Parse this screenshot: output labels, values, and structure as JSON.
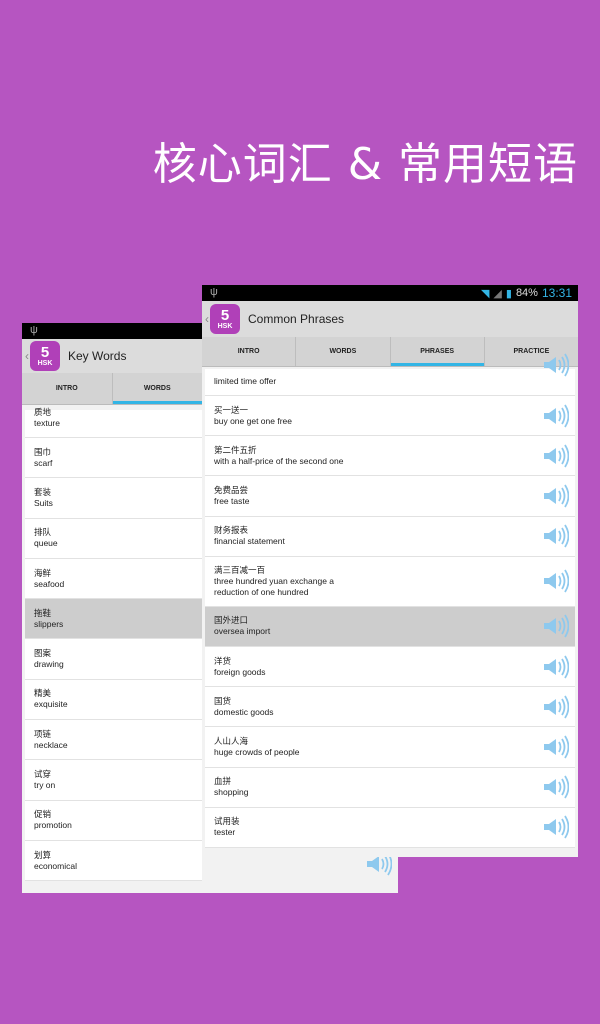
{
  "headline": "核心词汇 & 常用短语",
  "colors": {
    "background": "#b655c1",
    "accent": "#33b5e5",
    "selected_row": "#cdcdcd"
  },
  "back_phone": {
    "title": "Key Words",
    "logo": {
      "number": "5",
      "label": "HSK"
    },
    "tabs": [
      {
        "label": "INTRO"
      },
      {
        "label": "WORDS",
        "active": true
      }
    ],
    "items": [
      {
        "zh": "质地",
        "en": "texture"
      },
      {
        "zh": "围巾",
        "en": "scarf"
      },
      {
        "zh": "套装",
        "en": "Suits"
      },
      {
        "zh": "排队",
        "en": "queue"
      },
      {
        "zh": "海鲜",
        "en": "seafood"
      },
      {
        "zh": "拖鞋",
        "en": "slippers",
        "selected": true
      },
      {
        "zh": "图案",
        "en": "drawing"
      },
      {
        "zh": "精美",
        "en": "exquisite"
      },
      {
        "zh": "项链",
        "en": "necklace"
      },
      {
        "zh": "试穿",
        "en": "try on"
      },
      {
        "zh": "促销",
        "en": "promotion"
      },
      {
        "zh": "划算",
        "en": "economical"
      }
    ]
  },
  "front_phone": {
    "status": {
      "battery": "84%",
      "time": "13:31"
    },
    "title": "Common Phrases",
    "logo": {
      "number": "5",
      "label": "HSK"
    },
    "tabs": [
      {
        "label": "INTRO"
      },
      {
        "label": "WORDS"
      },
      {
        "label": "PHRASES",
        "active": true
      },
      {
        "label": "PRACTICE"
      }
    ],
    "items": [
      {
        "zh": "",
        "en": "limited time offer"
      },
      {
        "zh": "买一送一",
        "en": "buy one get one free"
      },
      {
        "zh": "第二件五折",
        "en": "with a half-price of the second one"
      },
      {
        "zh": "免费品尝",
        "en": "free taste"
      },
      {
        "zh": "财务报表",
        "en": "financial statement"
      },
      {
        "zh": "满三百减一百",
        "en": "three hundred yuan exchange a reduction of one hundred"
      },
      {
        "zh": "国外进口",
        "en": "oversea import",
        "selected": true
      },
      {
        "zh": "洋货",
        "en": "foreign goods"
      },
      {
        "zh": "国货",
        "en": "domestic goods"
      },
      {
        "zh": "人山人海",
        "en": "huge crowds of people"
      },
      {
        "zh": "血拼",
        "en": "shopping"
      },
      {
        "zh": "试用装",
        "en": "tester"
      }
    ]
  }
}
